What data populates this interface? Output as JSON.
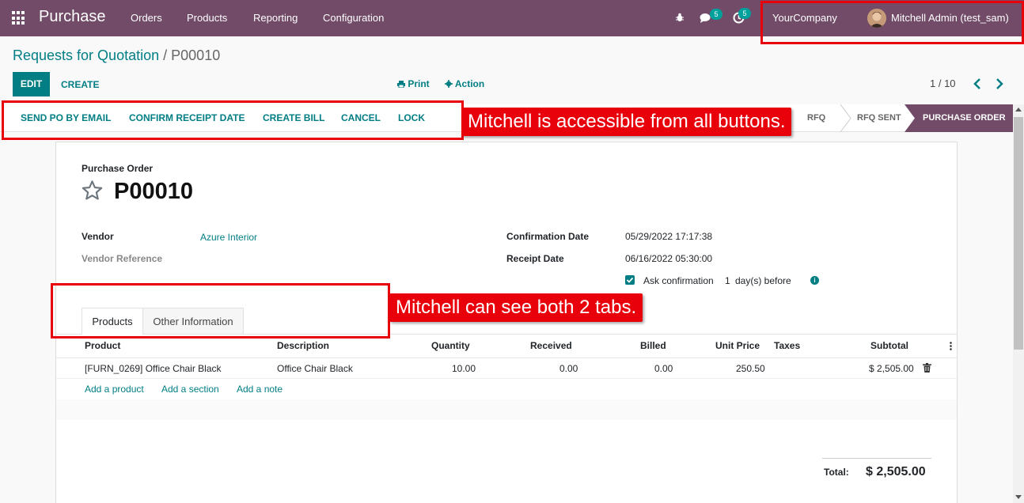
{
  "navbar": {
    "app_name": "Purchase",
    "menu": [
      "Orders",
      "Products",
      "Reporting",
      "Configuration"
    ],
    "messages_count": "5",
    "activities_count": "5",
    "company": "YourCompany",
    "user": "Mitchell Admin (test_sam)",
    "icons": [
      "apps-icon",
      "bug-icon",
      "chat-icon",
      "activity-icon",
      "avatar"
    ],
    "bg_color": "#714b67"
  },
  "breadcrumb": {
    "parent": "Requests for Quotation",
    "separator": "/",
    "current": "P00010"
  },
  "control_panel": {
    "edit_label": "EDIT",
    "create_label": "CREATE",
    "print_label": "Print",
    "action_label": "Action",
    "pager": "1 / 10"
  },
  "header_buttons": [
    "SEND PO BY EMAIL",
    "CONFIRM RECEIPT DATE",
    "CREATE BILL",
    "CANCEL",
    "LOCK"
  ],
  "stages": {
    "rfq": "RFQ",
    "rfq_sent": "RFQ SENT",
    "active": "PURCHASE ORDER"
  },
  "form": {
    "doc_label": "Purchase Order",
    "name": "P00010",
    "vendor_label": "Vendor",
    "vendor_value": "Azure Interior",
    "vendor_ref_label": "Vendor Reference",
    "confirmation_date_label": "Confirmation Date",
    "confirmation_date_value": "05/29/2022 17:17:38",
    "receipt_date_label": "Receipt Date",
    "receipt_date_value": "06/16/2022 05:30:00",
    "ask_confirmation_label": "Ask confirmation",
    "ask_confirmation_days": "1",
    "ask_confirmation_suffix": "day(s) before",
    "ask_confirmation_checked": true
  },
  "tabs": [
    {
      "label": "Products",
      "active": true
    },
    {
      "label": "Other Information",
      "active": false
    }
  ],
  "order_lines": {
    "columns": [
      "Product",
      "Description",
      "Quantity",
      "Received",
      "Billed",
      "Unit Price",
      "Taxes",
      "Subtotal"
    ],
    "rows": [
      {
        "product": "[FURN_0269] Office Chair Black",
        "description": "Office Chair Black",
        "quantity": "10.00",
        "received": "0.00",
        "billed": "0.00",
        "unit_price": "250.50",
        "taxes": "",
        "subtotal": "$ 2,505.00"
      }
    ],
    "add_links": [
      "Add a product",
      "Add a section",
      "Add a note"
    ]
  },
  "totals": {
    "label": "Total:",
    "value": "$ 2,505.00"
  },
  "annotations": [
    "Mitchell is accessible from all buttons.",
    "Mitchell can see both 2 tabs."
  ],
  "colors": {
    "accent": "#017e84",
    "brand": "#714b67",
    "annotation": "#e8000b"
  }
}
